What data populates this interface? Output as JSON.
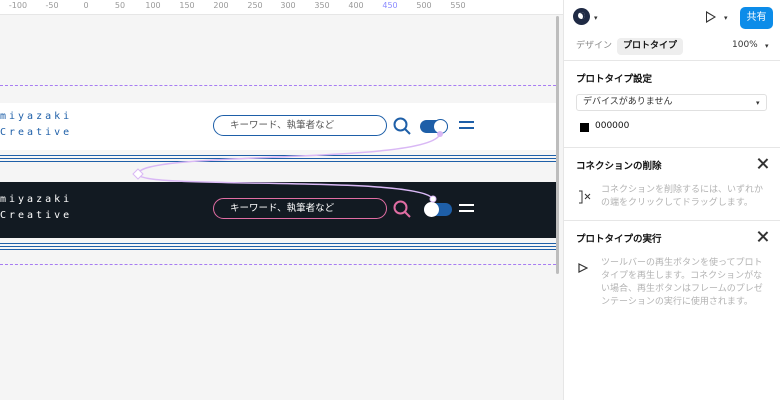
{
  "ruler": {
    "ticks": [
      "-100",
      "-50",
      "0",
      "50",
      "100",
      "150",
      "200",
      "250",
      "300",
      "350",
      "400",
      "450",
      "500",
      "550"
    ]
  },
  "design": {
    "logo_line1": "miyazaki",
    "logo_line2": "Creative",
    "search_placeholder": "キーワード、執筆者など",
    "colors": {
      "guide": "#a77cf2",
      "light_accent": "#1e5fa8",
      "dark_bg": "#121a22",
      "dark_accent": "#e06da3",
      "connector": "#d9b8f5"
    }
  },
  "panel": {
    "tabs": {
      "design": "デザイン",
      "prototype": "プロトタイプ"
    },
    "share_label": "共有",
    "zoom": "100%",
    "prototype_settings": {
      "title": "プロトタイプ設定",
      "device_value": "デバイスがありません",
      "color_value": "000000"
    },
    "delete_connection": {
      "title": "コネクションの削除",
      "description": "コネクションを削除するには、いずれかの端をクリックしてドラッグします。"
    },
    "run_prototype": {
      "title": "プロトタイプの実行",
      "description": "ツールバーの再生ボタンを使ってプロトタイプを再生します。コネクションがない場合、再生ボタンはフレームのプレゼンテーションの実行に使用されます。"
    }
  }
}
